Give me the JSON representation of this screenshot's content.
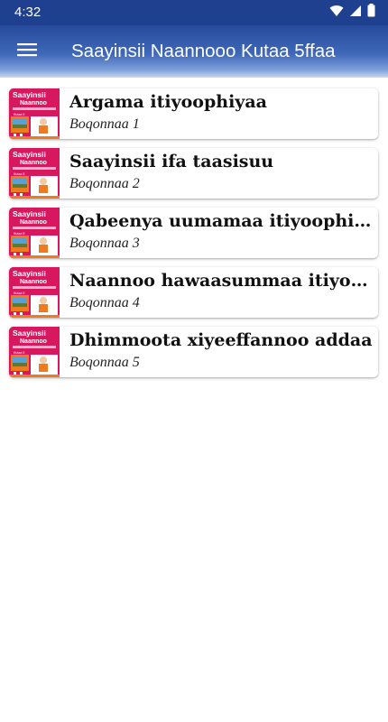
{
  "status_bar": {
    "time": "4:32",
    "icons": [
      "wifi-icon",
      "signal-icon",
      "battery-icon"
    ]
  },
  "app_bar": {
    "title": "Saayinsii Naannooo Kutaa 5ffaa",
    "menu_icon": "hamburger-menu-icon"
  },
  "colors": {
    "status_bar": "#1f3f8f",
    "app_bar": "#3f68b8",
    "cover_primary": "#d8185e",
    "cover_accent": "#f07a1e"
  },
  "chapters": [
    {
      "title": "Argama itiyoophiyaa",
      "subtitle": "Boqonnaa 1",
      "cover_title": "Saayinsii",
      "cover_subtitle": "Naannoo",
      "cover_badge": "Kutaa 5"
    },
    {
      "title": "Saayinsii ifa taasisuu",
      "subtitle": "Boqonnaa 2",
      "cover_title": "Saayinsii",
      "cover_subtitle": "Naannoo",
      "cover_badge": "Kutaa 5"
    },
    {
      "title": "Qabeenya uumamaa itiyoophiyaa",
      "subtitle": "Boqonnaa 3",
      "cover_title": "Saayinsii",
      "cover_subtitle": "Naannoo",
      "cover_badge": "Kutaa 5"
    },
    {
      "title": "Naannoo hawaasummaa itiyoophiyaa",
      "subtitle": "Boqonnaa 4",
      "cover_title": "Saayinsii",
      "cover_subtitle": "Naannoo",
      "cover_badge": "Kutaa 5"
    },
    {
      "title": "Dhimmoota xiyeeffannoo addaa",
      "subtitle": "Boqonnaa 5",
      "cover_title": "Saayinsii",
      "cover_subtitle": "Naannoo",
      "cover_badge": "Kutaa 5"
    }
  ]
}
